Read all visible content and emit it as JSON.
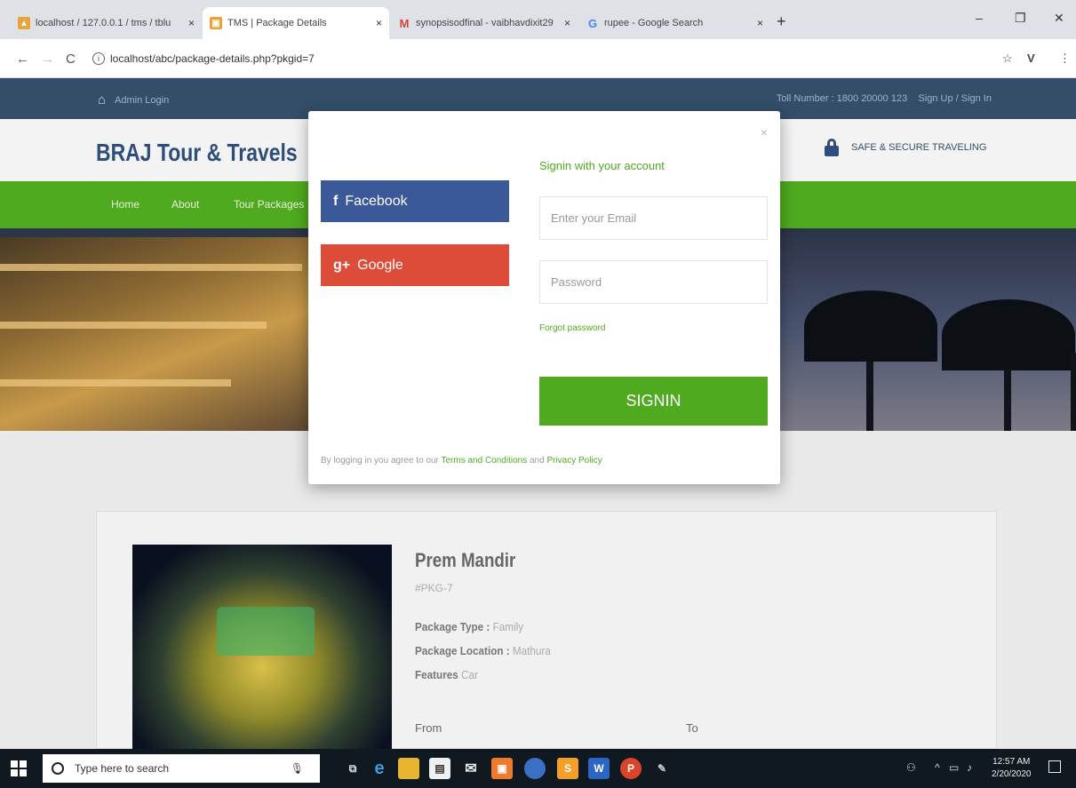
{
  "browser": {
    "tabs": [
      {
        "title": "localhost / 127.0.0.1 / tms / tblu",
        "active": false
      },
      {
        "title": "TMS | Package Details",
        "active": true
      },
      {
        "title": "synopsisodfinal - vaibhavdixit29",
        "active": false
      },
      {
        "title": "rupee - Google Search",
        "active": false
      }
    ],
    "url": "localhost/abc/package-details.php?pkgid=7"
  },
  "site": {
    "admin_login": "Admin Login",
    "toll_text": "Toll Number : 1800 20000 123",
    "signup_text": "Sign Up / Sign In",
    "brand": "BRAJ Tour & Travels",
    "secure_text": "SAFE & SECURE TRAVELING",
    "menu": [
      "Home",
      "About",
      "Tour Packages"
    ]
  },
  "modal": {
    "facebook_label": "Facebook",
    "google_label": "Google",
    "heading": "Signin with your account",
    "email_placeholder": "Enter your Email",
    "password_placeholder": "Password",
    "forgot": "Forgot password",
    "signin_button": "SIGNIN",
    "terms_prefix": "By logging in you agree to our",
    "terms_link": "Terms and Conditions",
    "terms_and": "and",
    "privacy_link": "Privacy Policy",
    "close": "×"
  },
  "package": {
    "title": "Prem Mandir",
    "id": "#PKG-7",
    "type_label": "Package Type :",
    "type_value": "Family",
    "location_label": "Package Location :",
    "location_value": "Mathura",
    "features_label": "Features",
    "features_value": "Car",
    "from_label": "From",
    "to_label": "To"
  },
  "taskbar": {
    "search_placeholder": "Type here to search",
    "time": "12:57 AM",
    "date": "2/20/2020"
  }
}
